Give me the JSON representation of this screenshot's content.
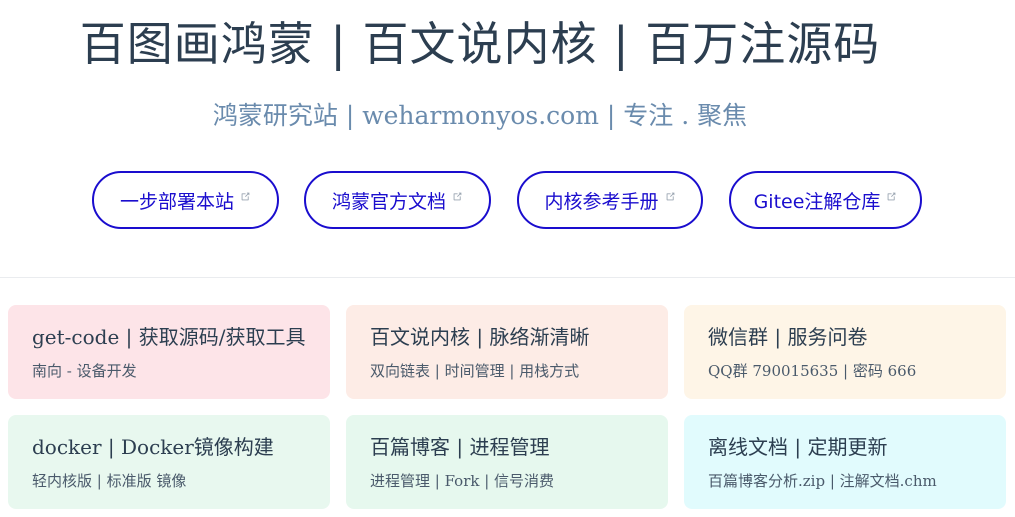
{
  "hero": {
    "title": "百图画鸿蒙 | 百文说内核 | 百万注源码",
    "description": "鸿蒙研究站 | weharmonyos.com | 专注 . 聚焦"
  },
  "actions": [
    {
      "label": "一步部署本站"
    },
    {
      "label": "鸿蒙官方文档"
    },
    {
      "label": "内核参考手册"
    },
    {
      "label": "Gitee注解仓库"
    }
  ],
  "colors": {
    "accent": "#1a0dce",
    "title": "#2c3e50",
    "subtitle": "#6a8bad",
    "card_pink": "#fde4e8",
    "card_peach": "#fdece6",
    "card_cream": "#fef5e7",
    "card_green": "#e8f8ef",
    "card_mint": "#e6f8ee",
    "card_cyan": "#e1fbfd"
  },
  "features": [
    {
      "title": "get-code | 获取源码/获取工具",
      "details": "南向 - 设备开发"
    },
    {
      "title": "百文说内核 | 脉络渐清晰",
      "details": "双向链表 | 时间管理 | 用栈方式"
    },
    {
      "title": "微信群 | 服务问卷",
      "details": "QQ群 790015635 | 密码 666"
    },
    {
      "title": "docker | Docker镜像构建",
      "details": "轻内核版 | 标准版 镜像"
    },
    {
      "title": "百篇博客 | 进程管理",
      "details": "进程管理 | Fork | 信号消费"
    },
    {
      "title": "离线文档 | 定期更新",
      "details": "百篇博客分析.zip | 注解文档.chm"
    }
  ]
}
